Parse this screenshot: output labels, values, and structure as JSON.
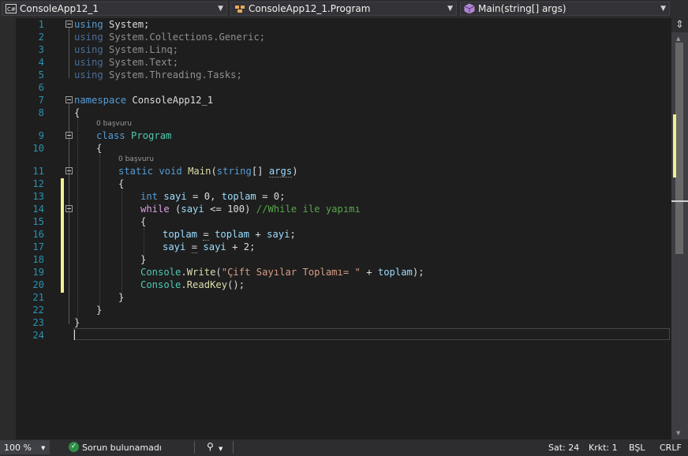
{
  "navbar": {
    "project": "ConsoleApp12_1",
    "type": "ConsoleApp12_1.Program",
    "member": "Main(string[] args)",
    "split_glyph": "⇕"
  },
  "editor": {
    "line_numbers": [
      "1",
      "2",
      "3",
      "4",
      "5",
      "6",
      "7",
      "8",
      "9",
      "10",
      "11",
      "12",
      "13",
      "14",
      "15",
      "16",
      "17",
      "18",
      "19",
      "20",
      "21",
      "22",
      "23",
      "24"
    ],
    "codelens": {
      "class_refs": "0 başvuru",
      "method_refs": "0 başvuru"
    },
    "tokens": {
      "using": "using",
      "system": "System;",
      "collections": "System.Collections.Generic;",
      "linq": "System.Linq;",
      "text": "System.Text;",
      "threading": "System.Threading.Tasks;",
      "namespace": "namespace",
      "ns_name": "ConsoleApp12_1",
      "open_brace": "{",
      "close_brace": "}",
      "class": "class",
      "class_name": "Program",
      "static": "static",
      "void": "void",
      "main": "Main",
      "open_paren": "(",
      "string": "string",
      "arr_sp": "[] ",
      "args": "args",
      "close_paren": ")",
      "int": "int",
      "sp": " ",
      "sayi": "sayi",
      "toplam": "toplam",
      "eq0_comma": " = 0, ",
      "eq0_semi": " = 0;",
      "while": "while",
      "while_open": " (",
      "lte100": " <= 100) ",
      "comment": "//While ile yapımı",
      "assign": "=",
      "plus": " + ",
      "plus2": " + 2;",
      "semi": ";",
      "console": "Console",
      "dot": ".",
      "write": "Write",
      "str_lit": "\"Çift Sayılar Toplamı= \"",
      "write_end": ");",
      "readkey": "ReadKey",
      "readkey_end": "();"
    }
  },
  "status": {
    "zoom": "100 %",
    "zoom_arrow": "▼",
    "issues_icon": "✓",
    "issues": "Sorun bulunamadı",
    "brush_icon": "⚲",
    "brush_arrow": "▼",
    "line": "Sat: 24",
    "col": "Krkt: 1",
    "space_mode": "BŞL",
    "line_ending": "CRLF"
  }
}
